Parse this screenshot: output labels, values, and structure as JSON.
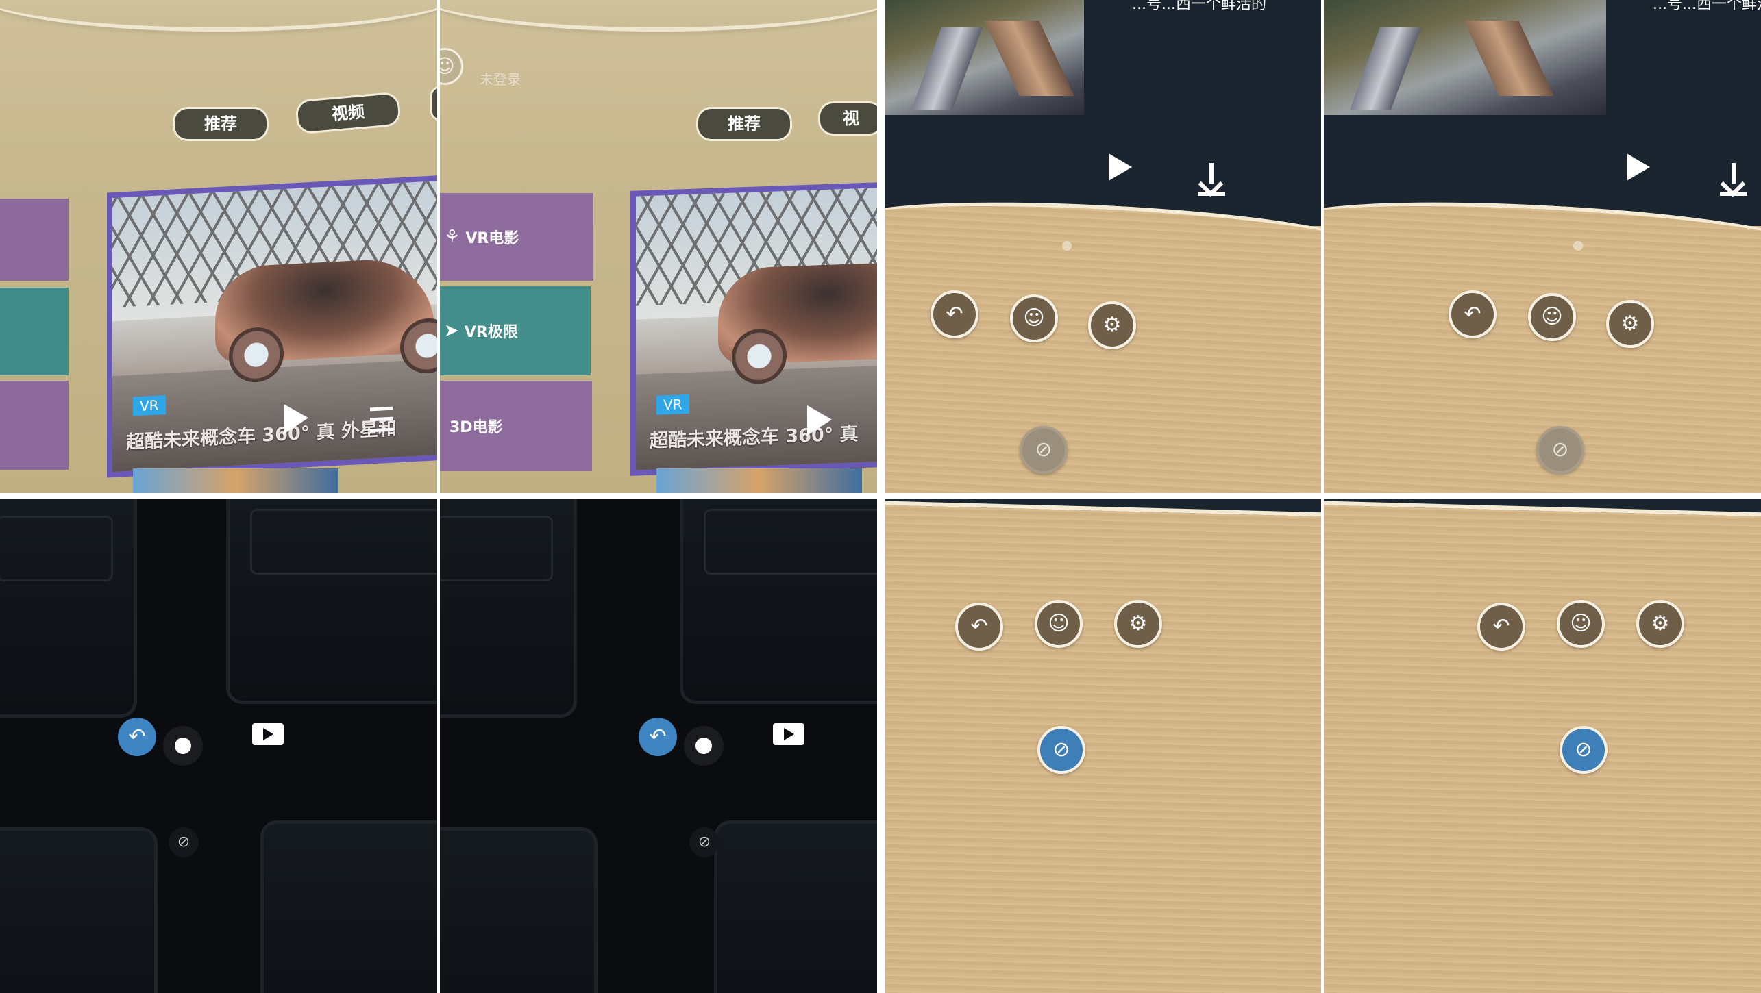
{
  "panel1": {
    "tabs": [
      "推荐",
      "视频",
      "视"
    ],
    "login_text": "未登录",
    "side_menu": [
      "VR电影",
      "VR极限",
      "3D电影"
    ],
    "featured": {
      "badge": "VR",
      "title_left": "超酷未来概念车 360° 真 外星和",
      "title_right": "超酷未来概念车 360° 真"
    },
    "icons": [
      "user-icon",
      "play-icon",
      "menu-icon"
    ]
  },
  "panel2": {
    "caption_left": "...号...西一个鲜活的",
    "caption_right": "...号...西一个鲜活的",
    "controls": [
      "back-icon",
      "user-icon",
      "settings-icon",
      "recenter-icon",
      "play-icon",
      "download-icon"
    ]
  },
  "panel3": {
    "controls": [
      "back-icon",
      "record-icon",
      "play-icon",
      "recenter-icon"
    ]
  },
  "panel4": {
    "controls": [
      "back-icon",
      "user-icon",
      "settings-icon",
      "recenter-icon"
    ]
  },
  "colors": {
    "room_beige": "#c7b88f",
    "accent_blue": "#3f7fb8",
    "button_brown": "#6f5e48",
    "feature_border": "#6a58b8",
    "vr_badge": "#2ea6e8",
    "navy_panel": "#1a2530"
  }
}
